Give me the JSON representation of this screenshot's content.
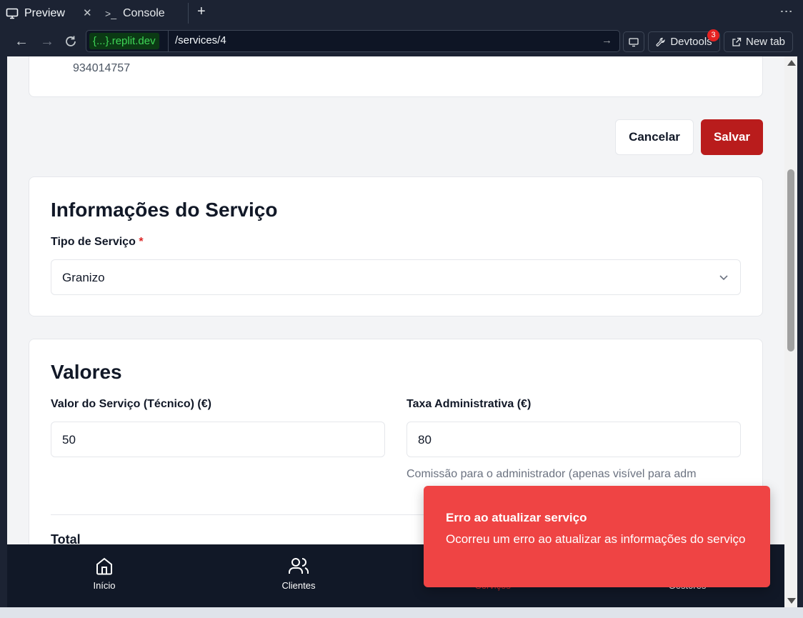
{
  "tabs": {
    "preview_label": "Preview",
    "console_label": "Console"
  },
  "address": {
    "domain_prefix": "{...}",
    "domain_suffix": ".replit.dev",
    "path": "/services/4"
  },
  "toolbar": {
    "devtools_label": "Devtools",
    "devtools_badge": "3",
    "newtab_label": "New tab"
  },
  "page": {
    "phone": "934014757",
    "cancel_label": "Cancelar",
    "save_label": "Salvar",
    "service_info": {
      "title": "Informações do Serviço",
      "type_label": "Tipo de Serviço",
      "required_mark": "*",
      "type_value": "Granizo"
    },
    "values": {
      "title": "Valores",
      "tech_label": "Valor do Serviço (Técnico) (€)",
      "tech_value": "50",
      "admin_label": "Taxa Administrativa (€)",
      "admin_value": "80",
      "admin_hint": "Comissão para o administrador (apenas visível para adm",
      "total_label": "Total"
    }
  },
  "bottom_nav": {
    "home": "Início",
    "clients": "Clientes",
    "services": "Serviços",
    "managers": "Gestores"
  },
  "toast": {
    "title": "Erro ao atualizar serviço",
    "message": "Ocorreu um erro ao atualizar as informações do serviço"
  },
  "colors": {
    "primary": "#b91c1c",
    "toast_bg": "#ef4444",
    "nav_bg": "#111827"
  }
}
